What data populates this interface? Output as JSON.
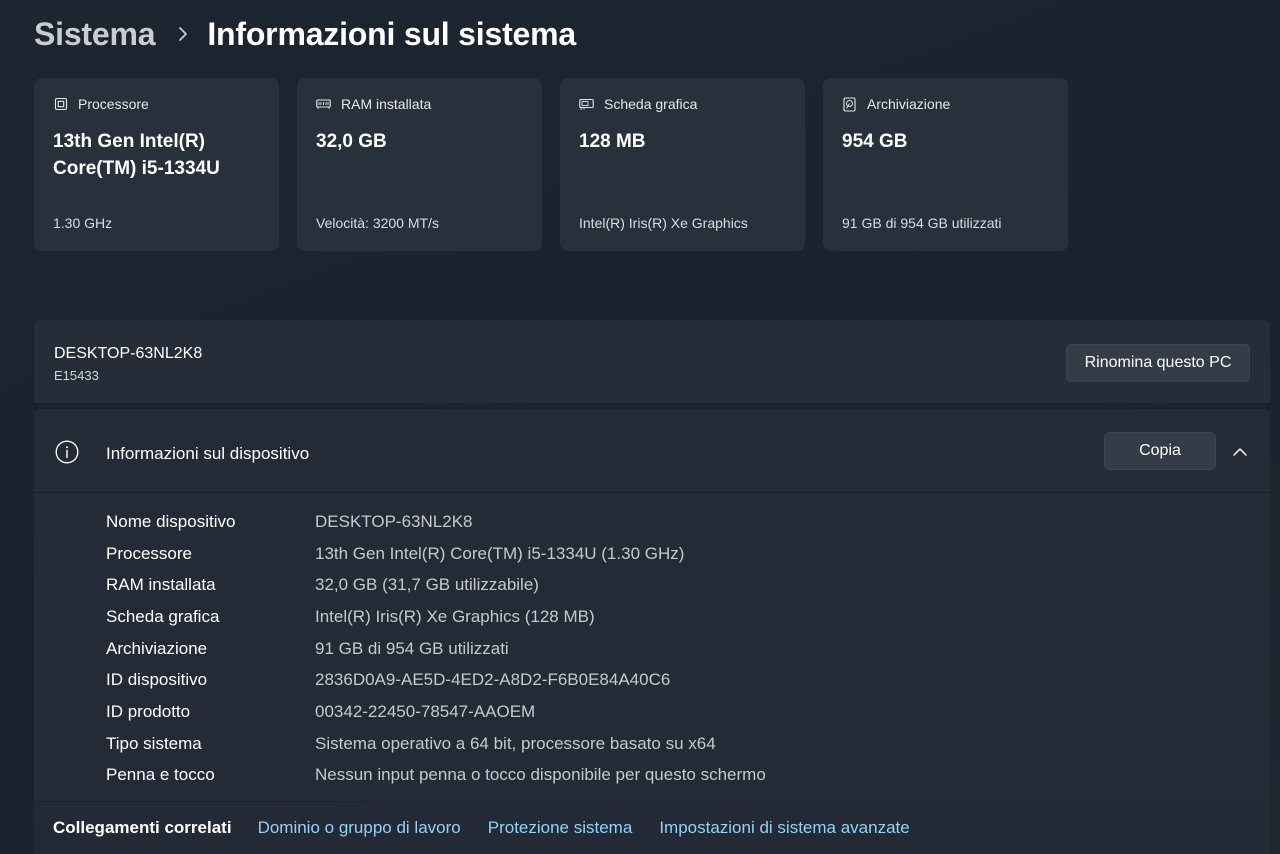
{
  "breadcrumb": {
    "parent": "Sistema",
    "current": "Informazioni sul sistema"
  },
  "cards": [
    {
      "icon": "processor-icon",
      "title": "Processore",
      "value": "13th Gen Intel(R) Core(TM) i5-1334U",
      "sub": "1.30 GHz"
    },
    {
      "icon": "ram-icon",
      "title": "RAM installata",
      "value": "32,0 GB",
      "sub": "Velocità: 3200 MT/s"
    },
    {
      "icon": "gpu-icon",
      "title": "Scheda grafica",
      "value": "128 MB",
      "sub": "Intel(R) Iris(R) Xe Graphics"
    },
    {
      "icon": "storage-icon",
      "title": "Archiviazione",
      "value": "954 GB",
      "sub": "91 GB di 954 GB utilizzati"
    }
  ],
  "pc": {
    "name": "DESKTOP-63NL2K8",
    "model": "E15433",
    "rename_label": "Rinomina questo PC"
  },
  "device": {
    "title": "Informazioni sul dispositivo",
    "copy_label": "Copia",
    "specs": [
      {
        "label": "Nome dispositivo",
        "value": "DESKTOP-63NL2K8"
      },
      {
        "label": "Processore",
        "value": "13th Gen Intel(R) Core(TM) i5-1334U (1.30 GHz)"
      },
      {
        "label": "RAM installata",
        "value": "32,0 GB (31,7 GB utilizzabile)"
      },
      {
        "label": "Scheda grafica",
        "value": "Intel(R) Iris(R) Xe Graphics (128 MB)"
      },
      {
        "label": "Archiviazione",
        "value": "91 GB di 954 GB utilizzati"
      },
      {
        "label": "ID dispositivo",
        "value": "2836D0A9-AE5D-4ED2-A8D2-F6B0E84A40C6"
      },
      {
        "label": "ID prodotto",
        "value": "00342-22450-78547-AAOEM"
      },
      {
        "label": "Tipo sistema",
        "value": "Sistema operativo a 64 bit, processore basato su x64"
      },
      {
        "label": "Penna e tocco",
        "value": "Nessun input penna o tocco disponibile per questo schermo"
      }
    ]
  },
  "related": {
    "label": "Collegamenti correlati",
    "links": [
      "Dominio o gruppo di lavoro",
      "Protezione sistema",
      "Impostazioni di sistema avanzate"
    ]
  },
  "colors": {
    "link": "#8fd3f7",
    "card_bg": "#28303c",
    "page_bg": "#1c2430"
  }
}
